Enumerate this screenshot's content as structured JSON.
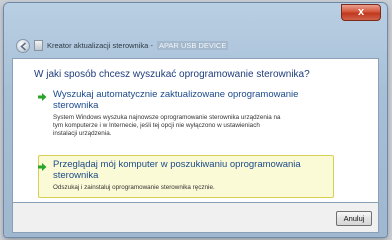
{
  "window": {
    "title_prefix": "Kreator aktualizacji sterownika - ",
    "title_device": "APAR USB DEVICE",
    "close_label": "x"
  },
  "heading": "W jaki sposób chcesz wyszukać oprogramowanie sterownika?",
  "options": [
    {
      "title": "Wyszukaj automatycznie zaktualizowane oprogramowanie sterownika",
      "description_lines": [
        "System Windows wyszuka najnowsze oprogramowanie sterownika urządzenia na",
        "tym komputerze i w Internecie, jeśli tej opcji nie wyłączono w ustawieniach",
        "instalacji urządzenia."
      ]
    },
    {
      "title": "Przeglądaj mój komputer w poszukiwaniu oprogramowania sterownika",
      "description_lines": [
        "Odszukaj i zainstaluj oprogramowanie sterownika ręcznie."
      ]
    }
  ],
  "footer": {
    "cancel_label": "Anuluj"
  },
  "colors": {
    "accent_green": "#2aa52a",
    "heading_blue": "#1f3d7a",
    "highlight_fill": "#fbfad6",
    "highlight_border": "#d8cf55"
  }
}
